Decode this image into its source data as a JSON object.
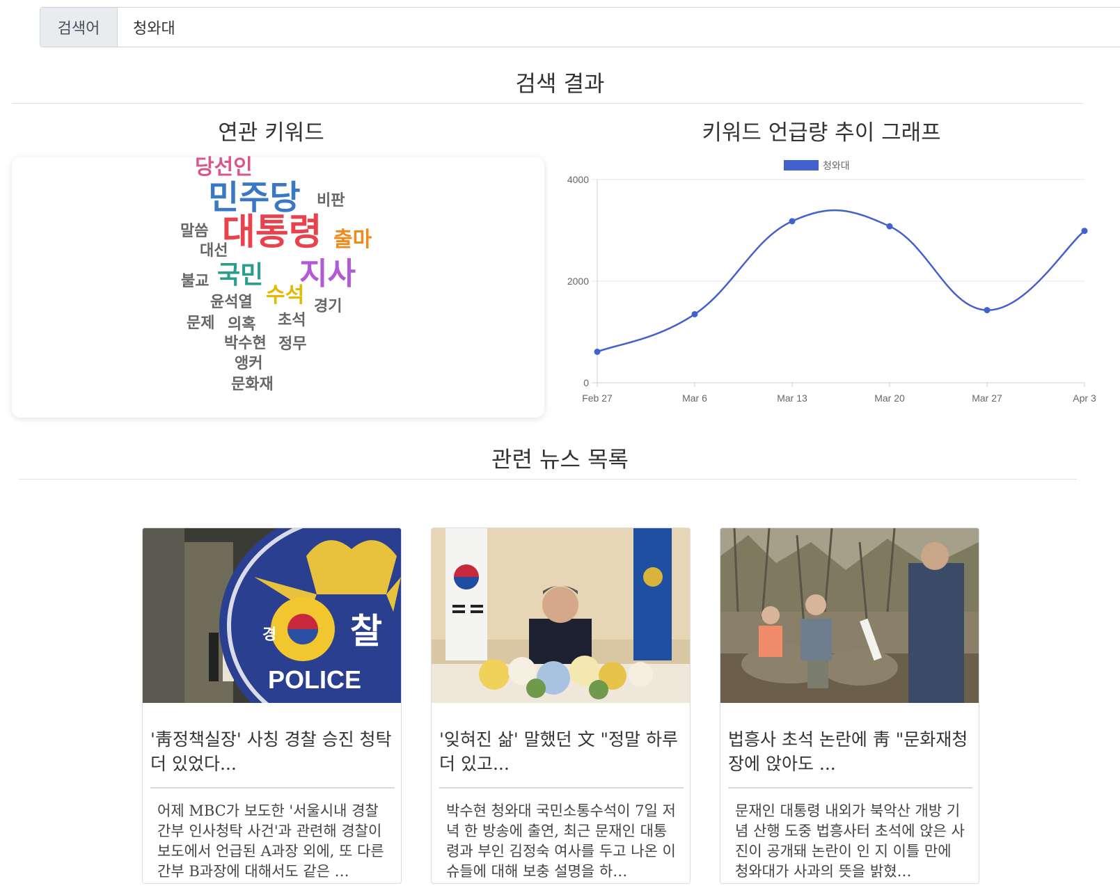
{
  "search": {
    "label": "검색어",
    "value": "청와대"
  },
  "results_title": "검색 결과",
  "keywords_title": "연관 키워드",
  "trend_title": "키워드 언급량 추이 그래프",
  "news_title": "관련 뉴스 목록",
  "word_cloud": [
    {
      "text": "당선인",
      "color": "#d9558c",
      "weight": 3
    },
    {
      "text": "민주당",
      "color": "#3b78c4",
      "weight": 5
    },
    {
      "text": "비판",
      "color": "#666666",
      "weight": 1
    },
    {
      "text": "말씀",
      "color": "#666666",
      "weight": 1
    },
    {
      "text": "대통령",
      "color": "#e8434c",
      "weight": 6
    },
    {
      "text": "출마",
      "color": "#f08a1c",
      "weight": 2
    },
    {
      "text": "대선",
      "color": "#666666",
      "weight": 1
    },
    {
      "text": "불교",
      "color": "#666666",
      "weight": 1
    },
    {
      "text": "국민",
      "color": "#2a9d8f",
      "weight": 4
    },
    {
      "text": "지사",
      "color": "#b25ad6",
      "weight": 5
    },
    {
      "text": "수석",
      "color": "#e6b800",
      "weight": 3
    },
    {
      "text": "윤석열",
      "color": "#666666",
      "weight": 1
    },
    {
      "text": "경기",
      "color": "#666666",
      "weight": 1
    },
    {
      "text": "문제",
      "color": "#666666",
      "weight": 1
    },
    {
      "text": "의혹",
      "color": "#666666",
      "weight": 1
    },
    {
      "text": "초석",
      "color": "#666666",
      "weight": 1
    },
    {
      "text": "박수현",
      "color": "#666666",
      "weight": 1
    },
    {
      "text": "정무",
      "color": "#666666",
      "weight": 1
    },
    {
      "text": "앵커",
      "color": "#666666",
      "weight": 1
    },
    {
      "text": "문화재",
      "color": "#666666",
      "weight": 1
    }
  ],
  "chart_data": {
    "type": "line",
    "categories": [
      "Feb 27",
      "Mar 6",
      "Mar 13",
      "Mar 20",
      "Mar 27",
      "Apr 3"
    ],
    "series": [
      {
        "name": "청와대",
        "values": [
          610,
          1350,
          3180,
          3080,
          1430,
          2990
        ],
        "color": "#4361cc"
      }
    ],
    "ylim": [
      0,
      4000
    ],
    "yticks": [
      0,
      2000,
      4000
    ],
    "legend": "top-center",
    "grid": true,
    "curve": "smooth"
  },
  "news": [
    {
      "image": "police-badge-photo",
      "title": "'靑정책실장' 사칭 경찰 승진 청탁 더 있었다...",
      "description": "어제 MBC가 보도한 '서울시내 경찰 간부 인사청탁 사건'과 관련해 경찰이 보도에서 언급된 A과장 외에, 또 다른 간부 B과장에 대해서도 같은 …"
    },
    {
      "image": "president-meeting-photo",
      "title": "'잊혀진 삶' 말했던 文 \"정말 하루 더 있고...",
      "description": "박수현 청와대 국민소통수석이 7일 저녁 한 방송에 출연, 최근 문재인 대통령과 부인 김정숙 여사를 두고 나온 이슈들에 대해 보충 설명을 하…"
    },
    {
      "image": "mountain-hike-photo",
      "title": "법흥사 초석 논란에 靑 \"문화재청장에 앉아도 ...",
      "description": "문재인 대통령 내외가 북악산 개방 기념 산행 도중 법흥사터 초석에 앉은 사진이 공개돼 논란이 인 지 이틀 만에 청와대가 사과의 뜻을 밝혔…"
    }
  ]
}
